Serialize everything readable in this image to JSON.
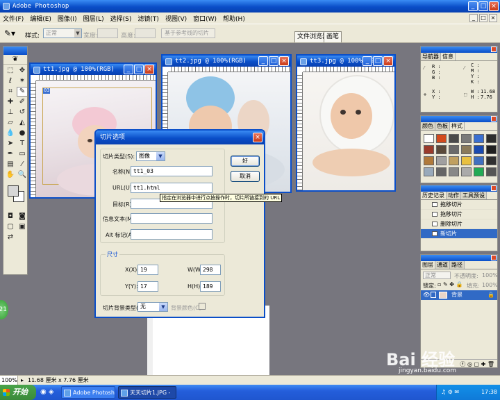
{
  "app": {
    "title": "Adobe Photoshop",
    "menu": [
      "文件(F)",
      "编辑(E)",
      "图像(I)",
      "图层(L)",
      "选择(S)",
      "滤镜(T)",
      "视图(V)",
      "窗口(W)",
      "帮助(H)"
    ]
  },
  "options_bar": {
    "style_label": "样式:",
    "style_value": "正常",
    "width_label": "宽度:",
    "height_label": "高度:",
    "guides_button": "基于参考线的切片",
    "tab_file_browser": "文件浏览器",
    "tab_brushes": "画笔"
  },
  "documents": [
    {
      "title": "tt1.jpg @ 100%(RGB)",
      "slice_badge": "03"
    },
    {
      "title": "tt2.jpg @ 100%(RGB)"
    },
    {
      "title": "tt3.jpg @ 100%(RGB)"
    }
  ],
  "dialog": {
    "title": "切片选项",
    "slice_type_label": "切片类型(S):",
    "slice_type_value": "图像",
    "name_label": "名称(N):",
    "name_value": "tt1_03",
    "url_label": "URL(U):",
    "url_value": "tt1.html",
    "target_label": "目标(R):",
    "target_value": "",
    "message_label": "信息文本(M):",
    "message_value": "",
    "alt_label": "Alt 标记(A):",
    "alt_value": "",
    "ok_button": "好",
    "cancel_button": "取消",
    "dimensions_title": "尺寸",
    "x_label": "X(X):",
    "x_value": "19",
    "y_label": "Y(Y):",
    "y_value": "17",
    "w_label": "W(W):",
    "w_value": "298",
    "h_label": "H(H):",
    "h_value": "189",
    "bg_type_label": "切片背景类型(L):",
    "bg_type_value": "无",
    "bg_color_label": "背景颜色(C):"
  },
  "tooltip": "指定在浏览器中进行点按操作时，切片所链接到的 URL",
  "navigator_palette": {
    "tabs": [
      "导航器",
      "信息"
    ],
    "labels": {
      "r": "R :",
      "g": "G :",
      "b": "B :",
      "c": "C :",
      "m": "M :",
      "y": "Y :",
      "k": "K :",
      "x": "X :",
      "yy": "Y :",
      "w": "W :",
      "h": "H :"
    },
    "w_value": "11.68",
    "h_value": "7.76"
  },
  "styles_palette": {
    "tabs": [
      "颜色",
      "色板",
      "样式"
    ],
    "swatches": [
      "#ffffff",
      "#d24a1c",
      "#4a4a4a",
      "#7a7a7a",
      "#3a6fd0",
      "#2d2d2d",
      "#9a3b2a",
      "#5a4a3a",
      "#6a6a6a",
      "#8a7a5a",
      "#1a4ab0",
      "#202020",
      "#b07a3a",
      "#a0a0a0",
      "#c0a060",
      "#e8c040",
      "#4070c0",
      "#303030",
      "#9ab",
      "#666",
      "#888",
      "#aaa",
      "#2a5",
      "#555"
    ]
  },
  "history_palette": {
    "tabs": [
      "历史记录",
      "动作",
      "工具预设"
    ],
    "items": [
      "拖移切片",
      "拖移切片",
      "删除切片",
      "新切片"
    ]
  },
  "layers_palette": {
    "tabs": [
      "图层",
      "通道",
      "路径"
    ],
    "blend_mode": "正常",
    "opacity_label": "不透明度:",
    "opacity_value": "100%",
    "lock_label": "锁定:",
    "fill_label": "填充:",
    "fill_value": "100%",
    "layer_name": "背景"
  },
  "status_bar": {
    "zoom": "100%",
    "dimensions": "11.68 厘米 x 7.76 厘米"
  },
  "taskbar": {
    "start": "开始",
    "tasks": [
      "Adobe Photoshop",
      "天天切片1.JPG -"
    ],
    "clock": "17:38"
  },
  "watermark": {
    "text": "Bai 经验",
    "url": "jingyan.baidu.com"
  },
  "side_badge": "21"
}
